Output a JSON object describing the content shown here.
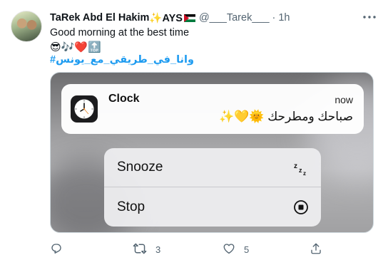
{
  "tweet": {
    "display_name": "TaRek Abd El Hakim",
    "name_suffix": "✨AYS",
    "flag_icon": "flag-icon",
    "handle": "@___Tarek___",
    "separator": "·",
    "time": "1h",
    "text_line1": "Good morning at the best time",
    "emoji_line": "😎🎶❤️🔝",
    "hashtag": "#وانا_في_طريقي_مع_يونس"
  },
  "media": {
    "notification": {
      "app_name": "Clock",
      "time": "now",
      "message": "✨💛🌞 صباحك ومطرحك",
      "icon": "clock-icon"
    },
    "menu": {
      "snooze_label": "Snooze",
      "snooze_icon": "zzz-icon",
      "stop_label": "Stop",
      "stop_icon": "stop-icon"
    }
  },
  "actions": {
    "reply_icon": "reply-icon",
    "retweet_icon": "retweet-icon",
    "retweet_count": "3",
    "like_icon": "heart-icon",
    "like_count": "5",
    "share_icon": "share-icon"
  },
  "colors": {
    "link": "#1d9bf0",
    "secondary_text": "#536471",
    "primary_text": "#0f1419"
  }
}
